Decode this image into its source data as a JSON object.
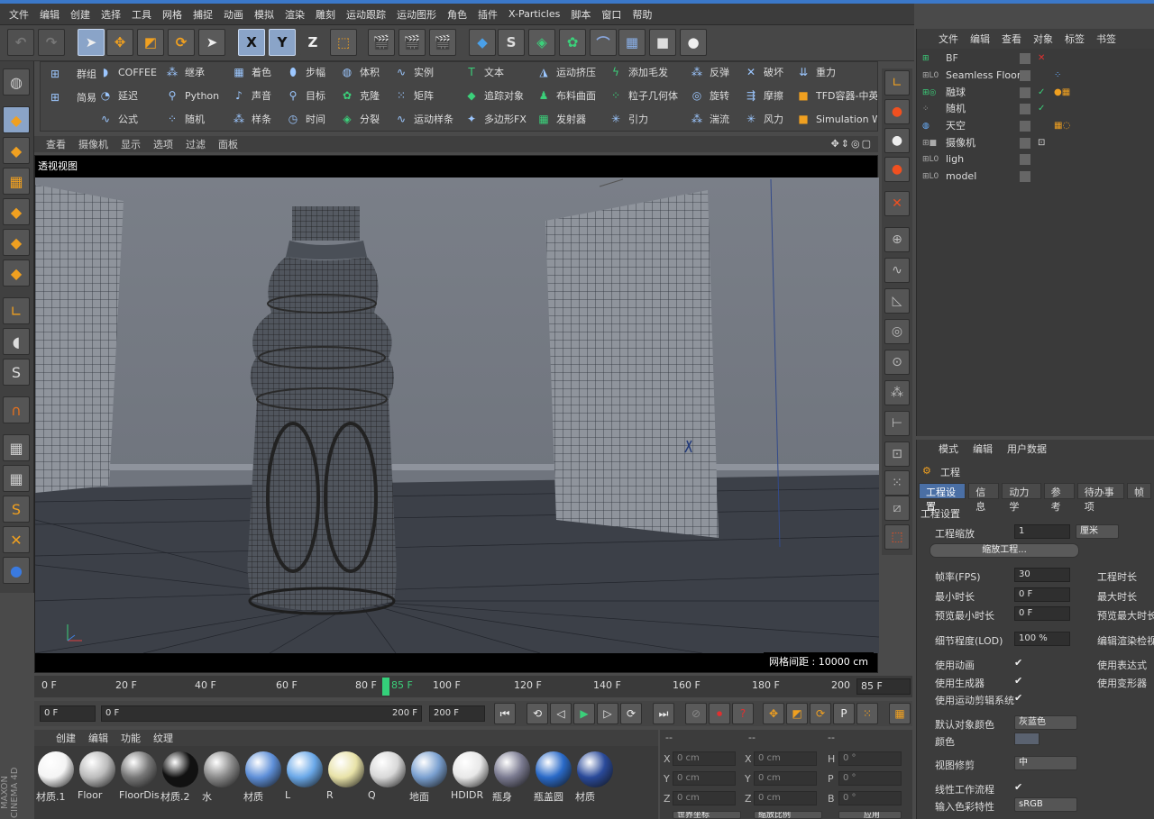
{
  "menubar": [
    "文件",
    "编辑",
    "创建",
    "选择",
    "工具",
    "网格",
    "捕捉",
    "动画",
    "模拟",
    "渲染",
    "雕刻",
    "运动跟踪",
    "运动图形",
    "角色",
    "插件",
    "X-Particles",
    "脚本",
    "窗口",
    "帮助"
  ],
  "toolbar": {
    "x_label": "X",
    "y_label": "Y",
    "z_label": "Z"
  },
  "palette": {
    "col1": [
      "群组",
      "简易"
    ],
    "col2": [
      "COFFEE",
      "延迟",
      "公式"
    ],
    "col3": [
      "继承",
      "Python",
      "随机"
    ],
    "col4": [
      "着色",
      "声音",
      "样条"
    ],
    "col5": [
      "步幅",
      "目标",
      "时间"
    ],
    "col6": [
      "体积",
      "克隆",
      "分裂"
    ],
    "col7": [
      "实例",
      "矩阵",
      "运动样条"
    ],
    "col8": [
      "文本",
      "追踪对象",
      "多边形FX"
    ],
    "col9": [
      "运动挤压",
      "布料曲面",
      "发射器"
    ],
    "col10": [
      "添加毛发",
      "粒子几何体",
      "引力"
    ],
    "col11": [
      "反弹",
      "旋转",
      "湍流"
    ],
    "col12": [
      "破坏",
      "摩擦",
      "风力"
    ],
    "col13": [
      "重力",
      "TFD容器-中英",
      "Simulation Wi"
    ]
  },
  "viewport": {
    "menu": [
      "查看",
      "摄像机",
      "显示",
      "选项",
      "过滤",
      "面板"
    ],
    "title": "透视视图",
    "grid_info": "网格间距 : 10000 cm"
  },
  "timeline": {
    "ticks": [
      "0 F",
      "20 F",
      "40 F",
      "60 F",
      "80 F",
      "85 F",
      "100 F",
      "120 F",
      "140 F",
      "160 F",
      "180 F",
      "200"
    ],
    "current_frame": "85 F"
  },
  "transport": {
    "start": "0 F",
    "range_start": "0 F",
    "range_end": "200 F",
    "end": "200 F"
  },
  "materials": {
    "menu": [
      "创建",
      "编辑",
      "功能",
      "纹理"
    ],
    "items": [
      {
        "name": "材质.1",
        "color": "#f4f4f4"
      },
      {
        "name": "Floor",
        "color": "#bcbcbc"
      },
      {
        "name": "FloorDis",
        "color": "#777777"
      },
      {
        "name": "材质.2",
        "color": "#111111"
      },
      {
        "name": "水",
        "color": "#8a8a8a"
      },
      {
        "name": "材质",
        "color": "#5e8fd8"
      },
      {
        "name": "L",
        "color": "#6aa8e8"
      },
      {
        "name": "R",
        "color": "#e8e2a8"
      },
      {
        "name": "Q",
        "color": "#d8d8d8"
      },
      {
        "name": "地面",
        "color": "#7aa0d0"
      },
      {
        "name": "HDIDR",
        "color": "#e8e8e8"
      },
      {
        "name": "瓶身",
        "color": "#7a7a90"
      },
      {
        "name": "瓶盖圆",
        "color": "#2a6ac8"
      },
      {
        "name": "材质",
        "color": "#2a4a9a"
      }
    ]
  },
  "coords": {
    "rows": [
      {
        "axis": "X",
        "pos": "0 cm",
        "size": "0 cm",
        "rot_label": "H",
        "rot": "0 °"
      },
      {
        "axis": "Y",
        "pos": "0 cm",
        "size": "0 cm",
        "rot_label": "P",
        "rot": "0 °"
      },
      {
        "axis": "Z",
        "pos": "0 cm",
        "size": "0 cm",
        "rot_label": "B",
        "rot": "0 °"
      }
    ],
    "world": "世界坐标",
    "scale": "缩放比例",
    "apply": "应用"
  },
  "logo": "MAXON CINEMA 4D",
  "object_manager": {
    "menu": [
      "文件",
      "编辑",
      "查看",
      "对象",
      "标签",
      "书签"
    ],
    "objects": [
      "BF",
      "Seamless Floor",
      "融球",
      "随机",
      "天空",
      "摄像机",
      "ligh",
      "model"
    ]
  },
  "attributes": {
    "menu": [
      "模式",
      "编辑",
      "用户数据"
    ],
    "title": "工程",
    "tabs": [
      "工程设置",
      "信息",
      "动力学",
      "参考",
      "待办事项",
      "帧"
    ],
    "section": "工程设置",
    "scale_label": "工程缩放",
    "scale_value": "1",
    "scale_unit": "厘米",
    "scale_button": "缩放工程...",
    "fps_label": "帧率(FPS)",
    "fps_value": "30",
    "project_time": "工程时长",
    "min_time_label": "最小时长",
    "min_time_value": "0 F",
    "max_time": "最大时长",
    "preview_min_label": "预览最小时长",
    "preview_min_value": "0 F",
    "preview_max": "预览最大时长",
    "lod_label": "细节程度(LOD)",
    "lod_value": "100 %",
    "render_lod": "编辑渲染检视",
    "use_anim": "使用动画",
    "use_expr": "使用表达式",
    "use_gen": "使用生成器",
    "use_deform": "使用变形器",
    "use_motion": "使用运动剪辑系统",
    "default_color_label": "默认对象颜色",
    "default_color_value": "灰蓝色",
    "color_label": "颜色",
    "clip_label": "视图修剪",
    "clip_value": "中",
    "linear_label": "线性工作流程",
    "input_color_label": "输入色彩特性",
    "input_color_value": "sRGB"
  },
  "accent": "#3b78c9"
}
